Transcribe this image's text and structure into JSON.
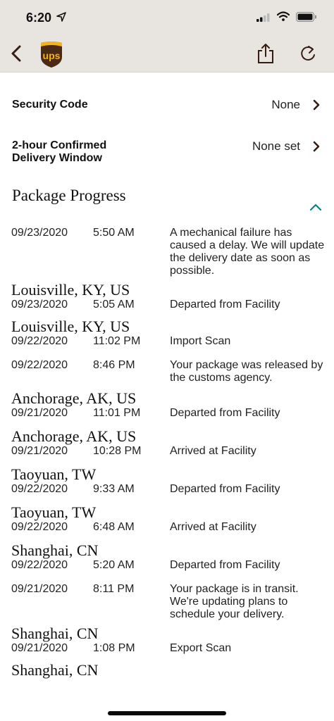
{
  "status_bar": {
    "time": "6:20"
  },
  "toolbar": {
    "logo_text": "ups"
  },
  "settings": [
    {
      "label": "Security Code",
      "value": "None"
    },
    {
      "label_line1": "2-hour Confirmed",
      "label_line2": "Delivery Window",
      "value": "None set"
    }
  ],
  "section_title": "Package Progress",
  "progress": [
    {
      "location": "",
      "date": "09/23/2020",
      "time": "5:50 AM",
      "desc": "A mechanical failure has caused a delay. We will update the delivery date as soon as possible."
    },
    {
      "location": "Louisville, KY, US",
      "date": "09/23/2020",
      "time": "5:05 AM",
      "desc": "Departed from Facility"
    },
    {
      "location": "Louisville, KY, US",
      "date": "09/22/2020",
      "time": "11:02 PM",
      "desc": "Import Scan"
    },
    {
      "location": "",
      "date": "09/22/2020",
      "time": "8:46 PM",
      "desc": "Your package was released by the customs agency."
    },
    {
      "location": "Anchorage, AK, US",
      "date": "09/21/2020",
      "time": "11:01 PM",
      "desc": "Departed from Facility"
    },
    {
      "location": "Anchorage, AK, US",
      "date": "09/21/2020",
      "time": "10:28 PM",
      "desc": "Arrived at Facility"
    },
    {
      "location": "Taoyuan, TW",
      "date": "09/22/2020",
      "time": "9:33 AM",
      "desc": "Departed from Facility"
    },
    {
      "location": "Taoyuan, TW",
      "date": "09/22/2020",
      "time": "6:48 AM",
      "desc": "Arrived at Facility"
    },
    {
      "location": "Shanghai, CN",
      "date": "09/22/2020",
      "time": "5:20 AM",
      "desc": "Departed from Facility"
    },
    {
      "location": "",
      "date": "09/21/2020",
      "time": "8:11 PM",
      "desc": "Your package is in transit. We're updating plans to schedule your delivery."
    },
    {
      "location": "Shanghai, CN",
      "date": "09/21/2020",
      "time": "1:08 PM",
      "desc": "Export Scan"
    },
    {
      "location": "Shanghai, CN",
      "date": "",
      "time": "",
      "desc": ""
    }
  ]
}
